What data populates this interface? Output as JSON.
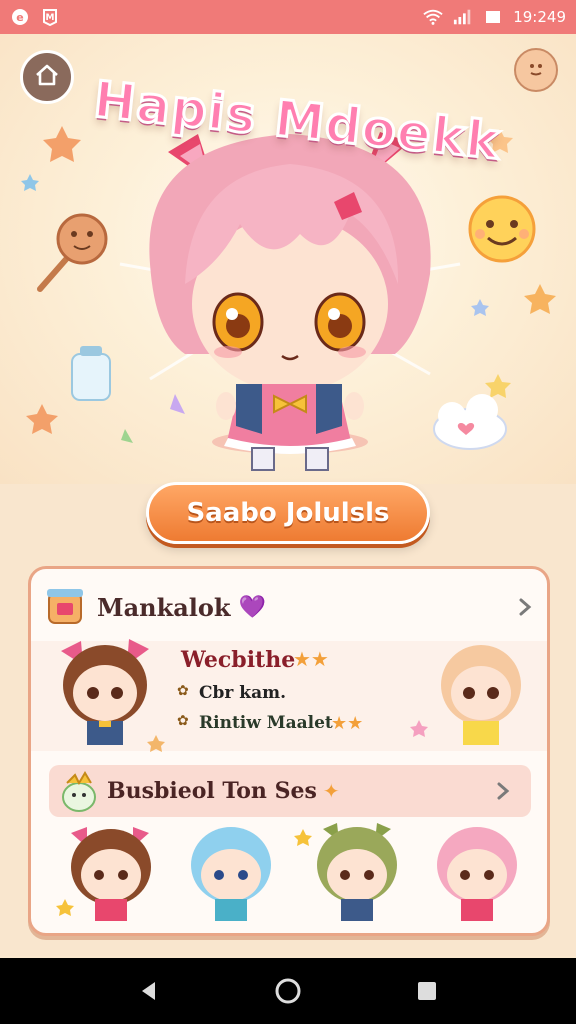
{
  "status_bar": {
    "time": "19:249",
    "left_icons": [
      "app-notification-icon",
      "app-badge-icon"
    ],
    "right_icons": [
      "wifi-icon",
      "signal-icon",
      "battery-icon"
    ]
  },
  "header": {
    "title": "Hapis Mdoekk",
    "back_icon": "back-house-icon",
    "profile_icon": "profile-face-icon"
  },
  "primary_action": {
    "label": "Saabo Jolulsls"
  },
  "panel": {
    "title": "Mankalok",
    "title_emoji": "💜",
    "detail": {
      "name": "Wecbithe",
      "line_2": "Cbr kam.",
      "line_3": "Rintiw Maalet"
    },
    "section": {
      "title": "Busbieol Ton Ses"
    }
  },
  "colors": {
    "status_bar": "#f07a78",
    "primary_button": "#ee7b32",
    "panel_border": "#e9a586",
    "background": "#fbe9cf"
  },
  "nav_bar": {
    "buttons": [
      "back-triangle-icon",
      "home-circle-icon",
      "recents-square-icon"
    ]
  }
}
